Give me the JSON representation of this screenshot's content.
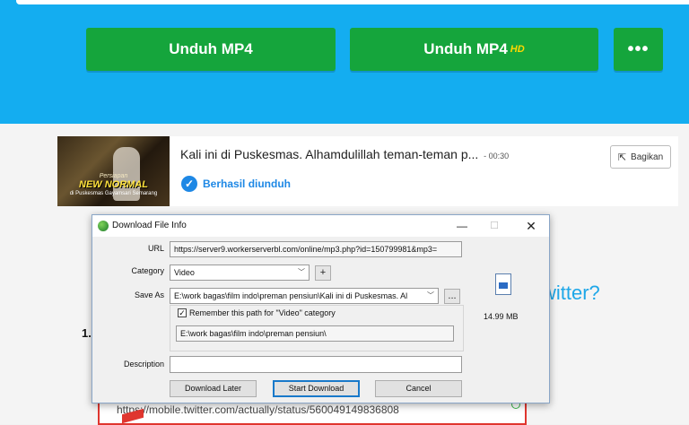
{
  "site": {
    "buttons": {
      "mp4": "Unduh MP4",
      "mp4_hd": "Unduh MP4",
      "hd_tag": "HD",
      "more": "•••"
    },
    "card": {
      "thumbnail_text": [
        "Persiapan",
        "NEW NORMAL",
        "di Puskesmas Gayamsari Semarang"
      ],
      "title": "Kali ini di Puskesmas. Alhamdulillah teman-teman p...",
      "duration": "- 00:30",
      "status": "Berhasil diunduh",
      "share": "Bagikan"
    },
    "twitter_heading_fragment": "witter?",
    "step_number": "1.",
    "url_example": "https://mobile.twitter.com/actually/status/560049149836808"
  },
  "dialog": {
    "title": "Download File Info",
    "window_controls": {
      "minimize": "—",
      "maximize": "☐",
      "close": "✕"
    },
    "url_label": "URL",
    "url_value": "https://server9.workerserverbl.com/online/mp3.php?id=150799981&mp3=",
    "category_label": "Category",
    "category_value": "Video",
    "add_category": "+",
    "save_as_label": "Save As",
    "save_as_value": "E:\\work bagas\\film indo\\preman pensiun\\Kali ini di Puskesmas. Al",
    "browse": "...",
    "remember_label": "Remember this path for \"Video\" category",
    "remember_checked": true,
    "remember_path": "E:\\work bagas\\film indo\\preman pensiun\\",
    "description_label": "Description",
    "description_value": "",
    "file_size": "14.99  MB",
    "buttons": {
      "later": "Download Later",
      "start": "Start Download",
      "cancel": "Cancel"
    }
  },
  "colors": {
    "band": "#14adf0",
    "green_button": "#15a53c",
    "status_blue": "#1e88e5",
    "url_border": "#e0362f"
  }
}
